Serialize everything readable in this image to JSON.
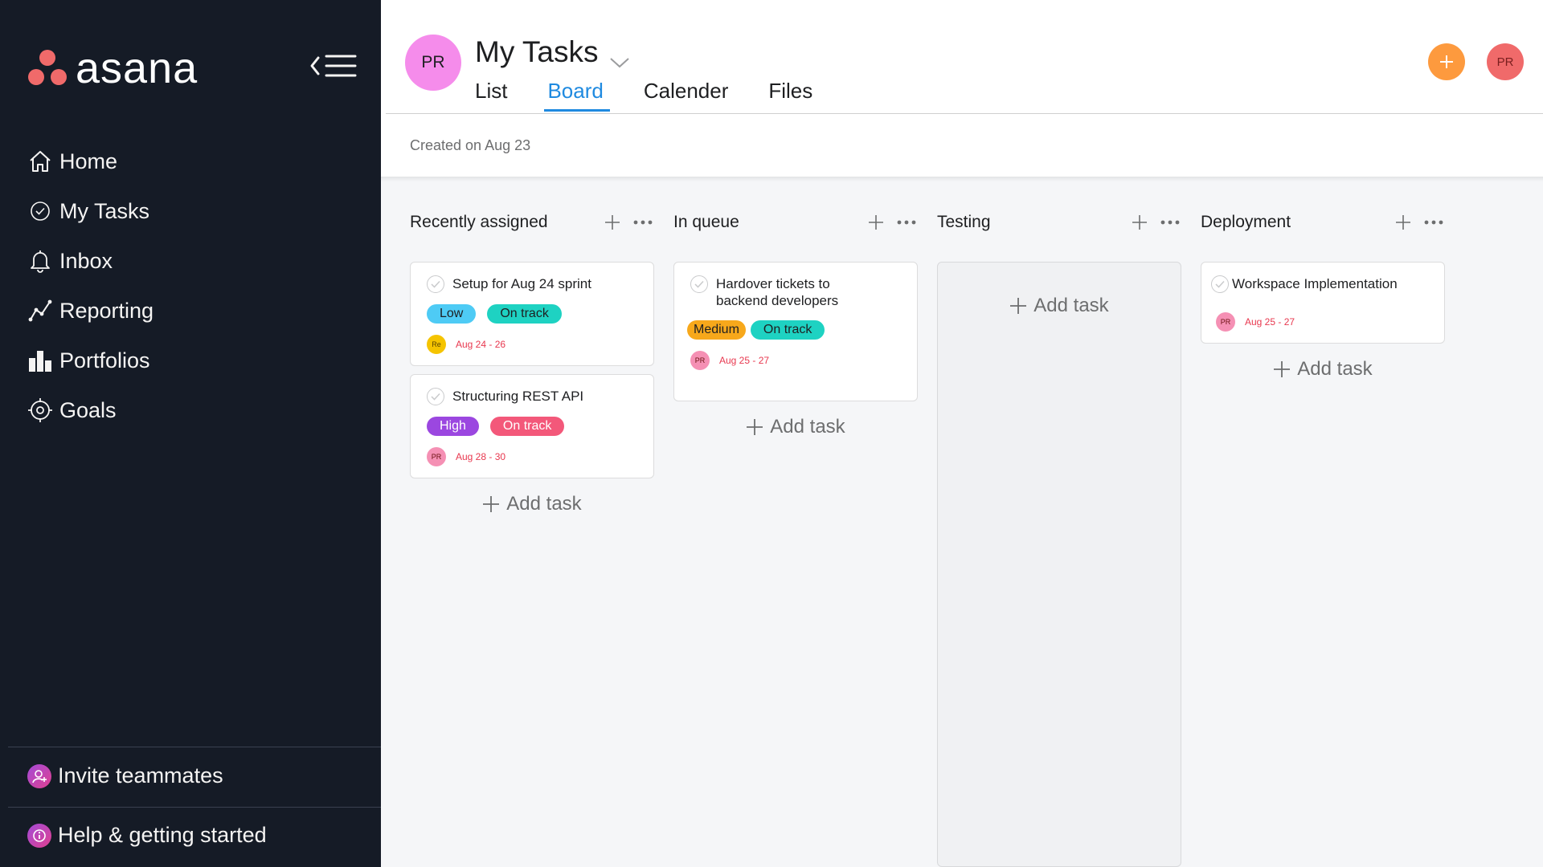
{
  "sidebar": {
    "logo_text": "asana",
    "nav": [
      {
        "label": "Home",
        "icon": "home-icon"
      },
      {
        "label": "My Tasks",
        "icon": "check-circle-icon"
      },
      {
        "label": "Inbox",
        "icon": "bell-icon"
      },
      {
        "label": "Reporting",
        "icon": "line-chart-icon"
      },
      {
        "label": "Portfolios",
        "icon": "bar-chart-icon"
      },
      {
        "label": "Goals",
        "icon": "target-icon"
      }
    ],
    "invite_label": "Invite teammates",
    "help_label": "Help & getting started"
  },
  "header": {
    "avatar_initials": "PR",
    "title": "My Tasks",
    "tabs": [
      "List",
      "Board",
      "Calender",
      "Files"
    ],
    "active_tab": "Board",
    "created": "Created on Aug 23",
    "user_initials": "PR"
  },
  "board": {
    "add_task_label": "Add task",
    "columns": [
      {
        "title": "Recently assigned",
        "cards": [
          {
            "title": "Setup for Aug 24 sprint",
            "priority": "Low",
            "priority_color": "#4ecbf5",
            "status": "On track",
            "status_color": "#1ed2c2",
            "assignee": "Re",
            "assignee_color": "#f5c400",
            "due": "Aug 24 - 26"
          },
          {
            "title": "Structuring REST API",
            "priority": "High",
            "priority_color": "#9b47e0",
            "status": "On track",
            "status_color": "#f3587a",
            "assignee": "PR",
            "assignee_color": "#f590b4",
            "due": "Aug 28 - 30"
          }
        ]
      },
      {
        "title": "In queue",
        "cards": [
          {
            "title": "Hardover tickets to backend developers",
            "priority": "Medium",
            "priority_color": "#f7a81b",
            "status": "On track",
            "status_color": "#1ed2c2",
            "assignee": "PR",
            "assignee_color": "#f590b4",
            "due": "Aug 25 - 27"
          }
        ]
      },
      {
        "title": "Testing",
        "cards": []
      },
      {
        "title": "Deployment",
        "cards": [
          {
            "title": "Workspace Implementation",
            "assignee": "PR",
            "assignee_color": "#f590b4",
            "due": "Aug 25 - 27"
          }
        ]
      }
    ]
  },
  "colors": {
    "sidebar_bg": "#151b26",
    "accent_blue": "#1f8ae0",
    "brand_coral": "#f06a6a",
    "add_orange": "#fd9a3e"
  }
}
